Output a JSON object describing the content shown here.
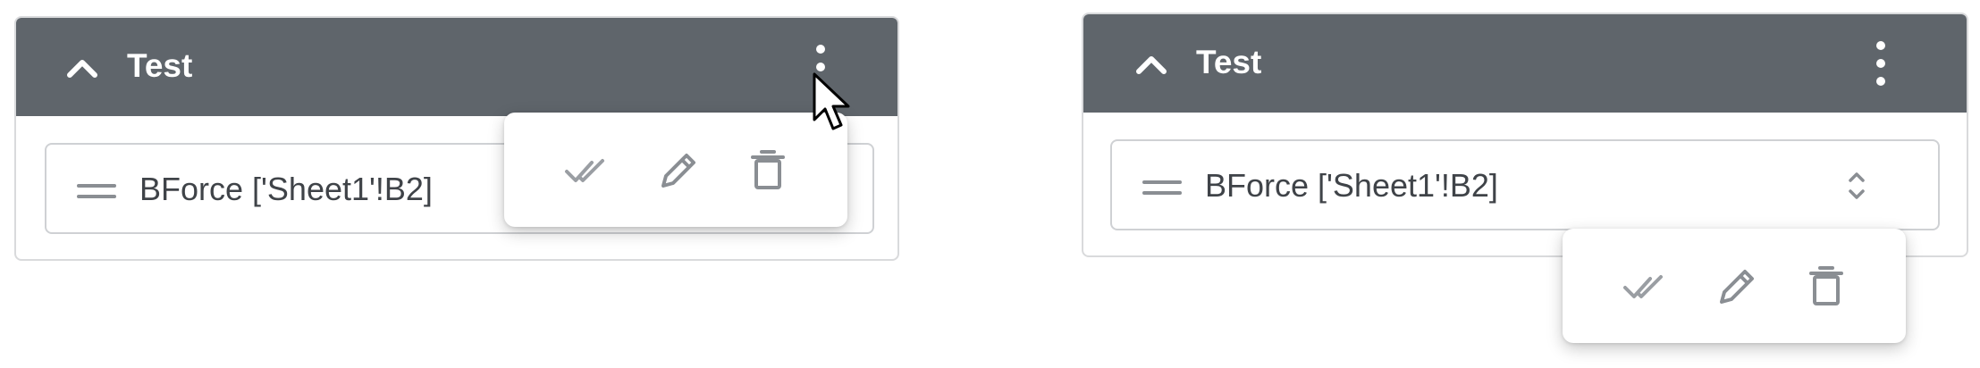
{
  "panels": [
    {
      "title": "Test",
      "field_text": "BForce ['Sheet1'!B2]",
      "actions": {
        "accept_icon": "double-check-icon",
        "edit_icon": "pencil-icon",
        "delete_icon": "trash-icon"
      }
    },
    {
      "title": "Test",
      "field_text": "BForce ['Sheet1'!B2]",
      "actions": {
        "accept_icon": "double-check-icon",
        "edit_icon": "pencil-icon",
        "delete_icon": "trash-icon"
      }
    }
  ],
  "icons": {
    "collapse": "chevron-up-icon",
    "menu": "more-vertical-icon",
    "drag": "drag-handle-icon",
    "sort": "up-down-arrow-icon",
    "pointer": "mouse-cursor-icon"
  },
  "colors": {
    "header_bg": "#5f656b",
    "header_text": "#ffffff",
    "border": "#d9dadc",
    "icon_muted": "#8a8e93",
    "text": "#3f4348"
  }
}
